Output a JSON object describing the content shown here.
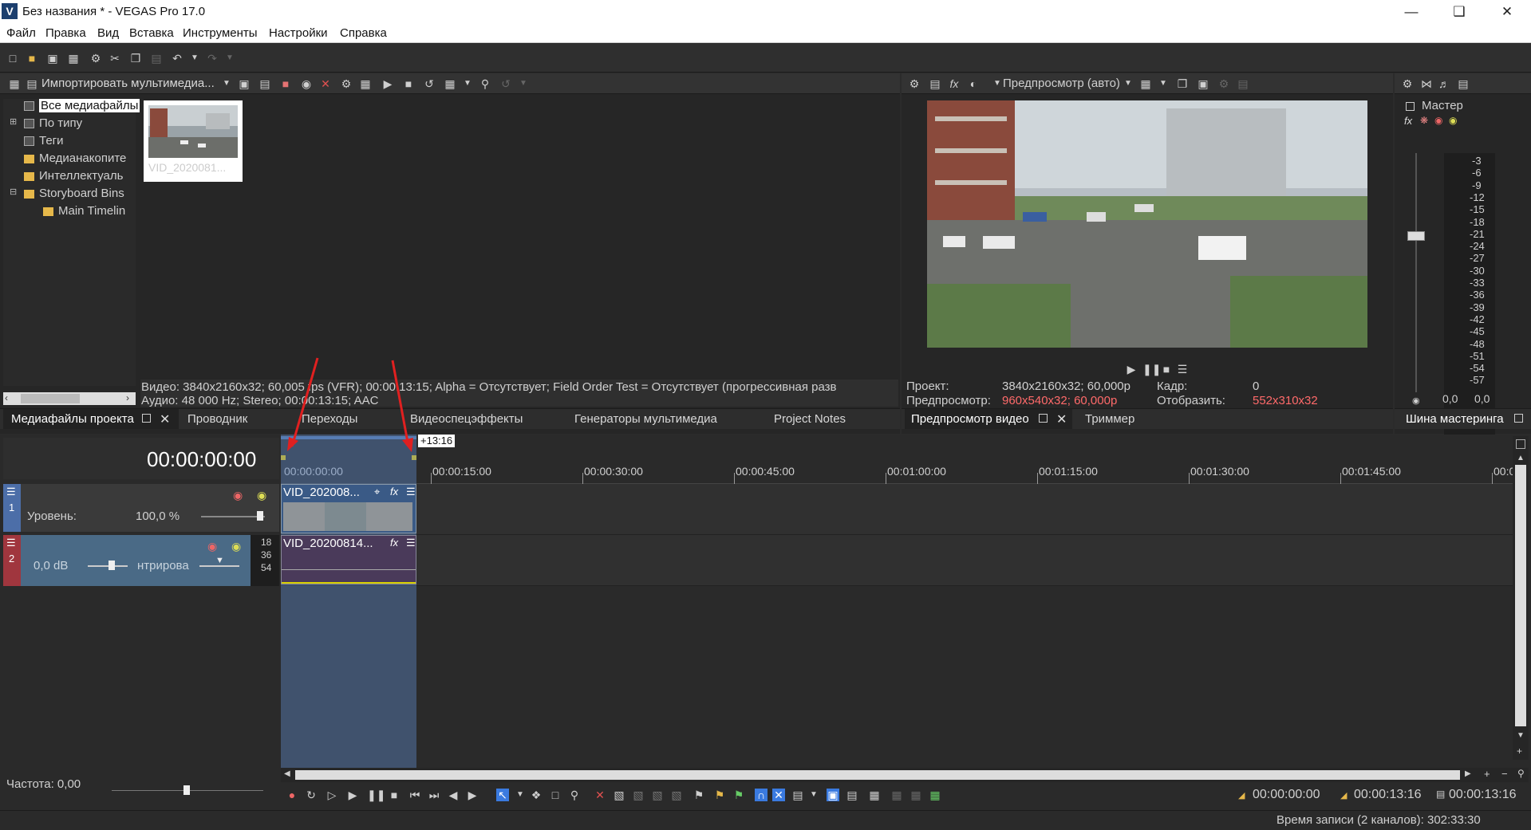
{
  "window": {
    "title": "Без названия * - VEGAS Pro 17.0",
    "app_icon": "V"
  },
  "menu": [
    "Файл",
    "Правка",
    "Вид",
    "Вставка",
    "Инструменты",
    "Настройки",
    "Справка"
  ],
  "media_panel": {
    "import_label": "Импортировать мультимедиа...",
    "tree": [
      "Все медиафайлы",
      "По типу",
      "Теги",
      "Медианакопите",
      "Интеллектуаль",
      "Storyboard Bins",
      "Main Timelin"
    ],
    "thumb_label": "VID_2020081...",
    "info_video": "Видео: 3840x2160x32; 60,005 fps (VFR); 00:00:13:15; Alpha = Отсутствует; Field Order Test = Отсутствует (прогрессивная разв",
    "info_audio": "Аудио: 48 000 Hz; Stereo; 00:00:13:15; AAC"
  },
  "left_tabs": [
    "Медиафайлы проекта",
    "Проводник",
    "Переходы",
    "Видеоспецэффекты",
    "Генераторы мультимедиа",
    "Project Notes"
  ],
  "preview": {
    "mode_label": "Предпросмотр (авто)",
    "project_label": "Проект:",
    "project_value": "3840x2160x32; 60,000p",
    "preview_label": "Предпросмотр:",
    "preview_value": "960x540x32; 60,000p",
    "frame_label": "Кадр:",
    "frame_value": "0",
    "display_label": "Отобразить:",
    "display_value": "552x310x32",
    "tabs": [
      "Предпросмотр видео",
      "Триммер"
    ]
  },
  "master": {
    "label": "Мастер",
    "scale": [
      "3",
      "6",
      "9",
      "12",
      "15",
      "18",
      "21",
      "24",
      "27",
      "30",
      "33",
      "36",
      "39",
      "42",
      "45",
      "48",
      "51",
      "54",
      "57"
    ],
    "left_val": "0,0",
    "right_val": "0,0",
    "tab": "Шина мастеринга"
  },
  "timeline": {
    "timecode": "00:00:00:00",
    "selection_len": "+13:16",
    "ruler": [
      "00:00:00:00",
      "00:00:15:00",
      "00:00:30:00",
      "00:00:45:00",
      "00:01:00:00",
      "00:01:15:00",
      "00:01:30:00",
      "00:01:45:00",
      "00:0"
    ],
    "video_track": {
      "num": "1",
      "level_label": "Уровень:",
      "level_value": "100,0 %",
      "clip_name": "VID_202008..."
    },
    "audio_track": {
      "num": "2",
      "volume": "0,0 dB",
      "pan_label": "нтрирова",
      "meter": [
        "18",
        "36",
        "54"
      ],
      "clip_name": "VID_20200814..."
    },
    "rate_label": "Частота: 0,00"
  },
  "status": {
    "tc_start": "00:00:00:00",
    "tc_end": "00:00:13:16",
    "tc_len": "00:00:13:16",
    "record_time": "Время записи (2 каналов): 302:33:30"
  }
}
